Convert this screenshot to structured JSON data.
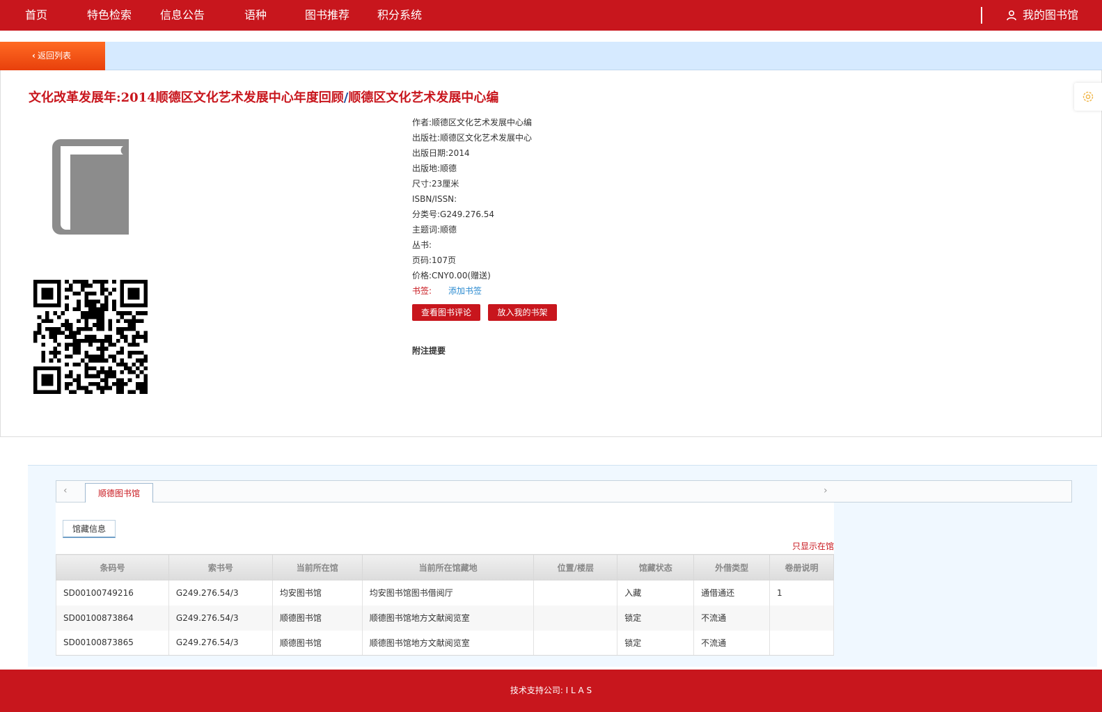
{
  "nav": {
    "items": [
      "首页",
      "特色检索",
      "信息公告",
      "语种",
      "图书推荐",
      "积分系统"
    ],
    "my_library": "我的图书馆"
  },
  "back_label": "返回列表",
  "book": {
    "title": "文化改革发展年:2014顺德区文化艺术发展中心年度回顾",
    "author_part": "顺德区文化艺术发展中心编",
    "fields": [
      {
        "label": "作者:",
        "value": "顺德区文化艺术发展中心编"
      },
      {
        "label": "出版社:",
        "value": "顺德区文化艺术发展中心"
      },
      {
        "label": "出版日期:",
        "value": "2014"
      },
      {
        "label": "出版地:",
        "value": "顺德"
      },
      {
        "label": "尺寸:",
        "value": "23厘米"
      },
      {
        "label": "ISBN/ISSN:",
        "value": ""
      },
      {
        "label": "分类号:",
        "value": "G249.276.54"
      },
      {
        "label": "主题词:",
        "value": "顺德"
      },
      {
        "label": "丛书:",
        "value": ""
      },
      {
        "label": "页码:",
        "value": "107页"
      },
      {
        "label": "价格:",
        "value": "CNY0.00(赠送)"
      }
    ],
    "bookmark_label": "书签:",
    "bookmark_link": "添加书签",
    "btn_reviews": "查看图书评论",
    "btn_shelf": "放入我的书架",
    "notes_label": "附注提要"
  },
  "holdings": {
    "library_tab": "顺德图书馆",
    "subtab": "馆藏信息",
    "only_in_library": "只显示在馆",
    "headers": [
      "条码号",
      "索书号",
      "当前所在馆",
      "当前所在馆藏地",
      "位置/楼层",
      "馆藏状态",
      "外借类型",
      "卷册说明"
    ],
    "rows": [
      [
        "SD00100749216",
        "G249.276.54/3",
        "均安图书馆",
        "均安图书馆图书借阅厅",
        "",
        "入藏",
        "通借通还",
        "1"
      ],
      [
        "SD00100873864",
        "G249.276.54/3",
        "顺德图书馆",
        "顺德图书馆地方文献阅览室",
        "",
        "锁定",
        "不流通",
        ""
      ],
      [
        "SD00100873865",
        "G249.276.54/3",
        "顺德图书馆",
        "顺德图书馆地方文献阅览室",
        "",
        "锁定",
        "不流通",
        ""
      ]
    ]
  },
  "footer": "技术支持公司: I L A S",
  "colors": {
    "brand_red": "#c8161d",
    "strip_blue": "#d6eaff",
    "back_orange": "#f05418"
  }
}
